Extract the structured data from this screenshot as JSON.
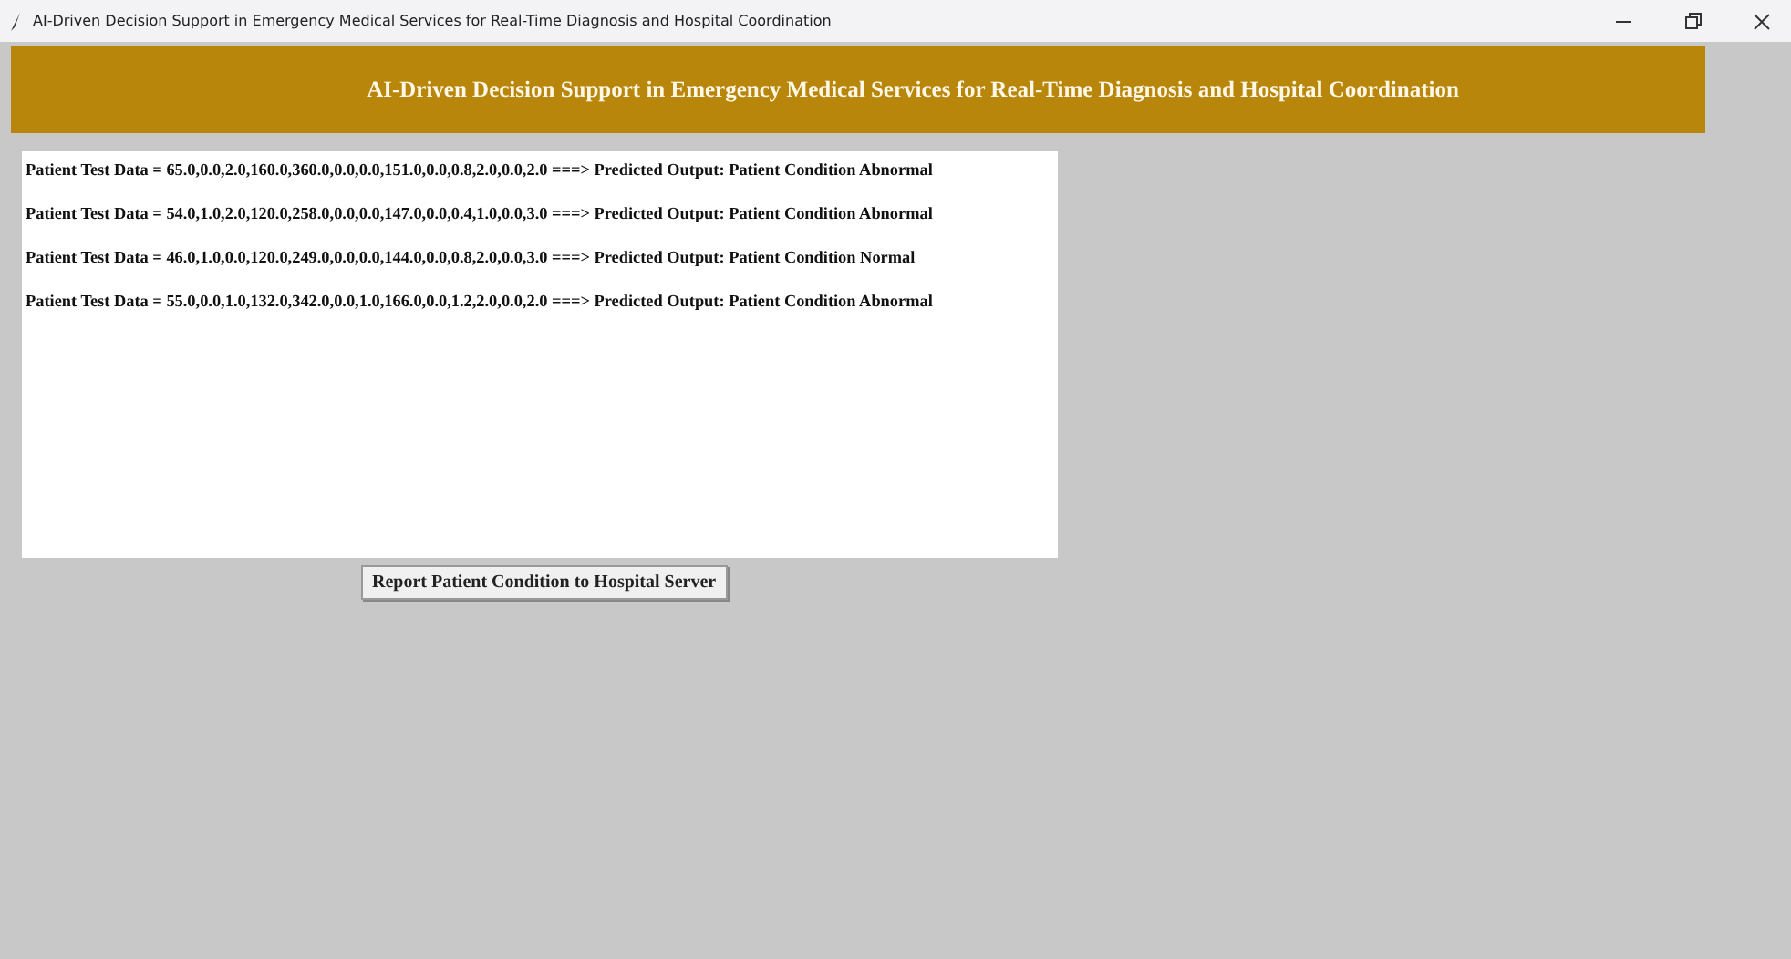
{
  "window": {
    "title": "AI-Driven Decision Support in Emergency Medical Services for Real-Time Diagnosis and Hospital Coordination"
  },
  "banner": {
    "title": "AI-Driven Decision Support in Emergency Medical Services for Real-Time Diagnosis and Hospital Coordination"
  },
  "output_lines": [
    "Patient Test Data = 65.0,0.0,2.0,160.0,360.0,0.0,0.0,151.0,0.0,0.8,2.0,0.0,2.0 ===> Predicted Output: Patient Condition Abnormal",
    "Patient Test Data = 54.0,1.0,2.0,120.0,258.0,0.0,0.0,147.0,0.0,0.4,1.0,0.0,3.0 ===> Predicted Output: Patient Condition Abnormal",
    "Patient Test Data = 46.0,1.0,0.0,120.0,249.0,0.0,0.0,144.0,0.0,0.8,2.0,0.0,3.0 ===> Predicted Output: Patient Condition Normal",
    "Patient Test Data = 55.0,0.0,1.0,132.0,342.0,0.0,1.0,166.0,0.0,1.2,2.0,0.0,2.0 ===> Predicted Output: Patient Condition Abnormal"
  ],
  "buttons": [
    "Report Patient Condition to Hospital Server"
  ]
}
